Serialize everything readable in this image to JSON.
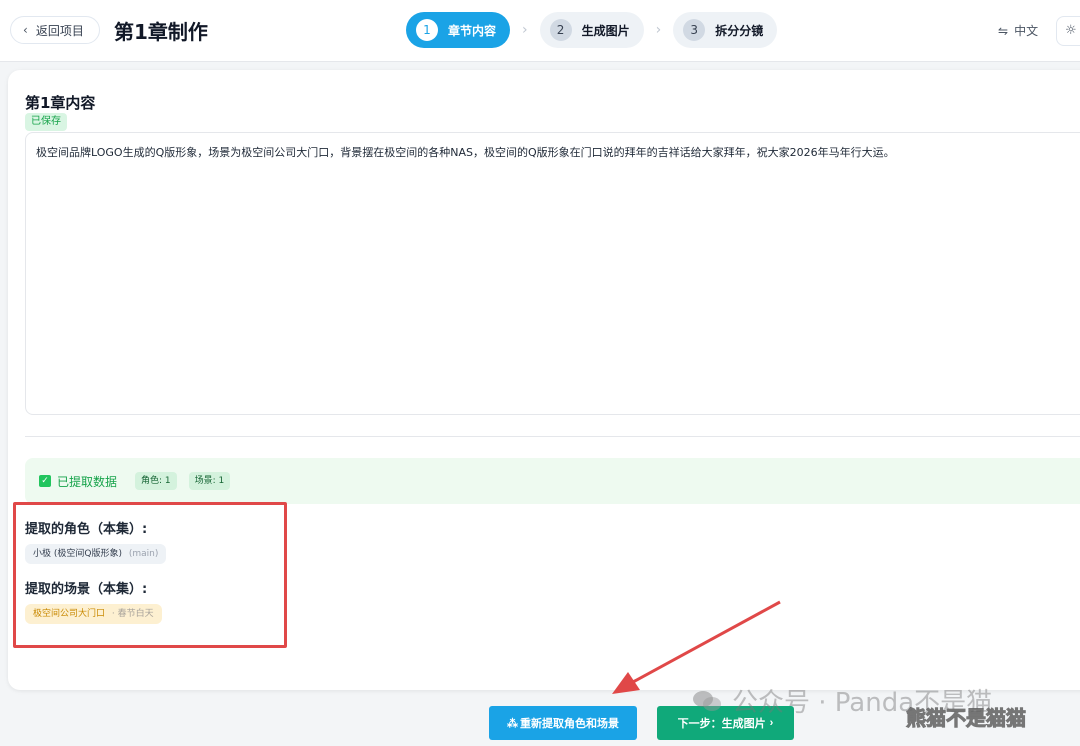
{
  "header": {
    "back_label": "返回项目",
    "title": "第1章制作",
    "steps": [
      {
        "num": "1",
        "label": "章节内容"
      },
      {
        "num": "2",
        "label": "生成图片"
      },
      {
        "num": "3",
        "label": "拆分分镜"
      }
    ],
    "lang_label": "中文"
  },
  "content": {
    "section_title": "第1章内容",
    "saved_badge": "已保存",
    "chapter_text": "极空间品牌LOGO生成的Q版形象，场景为极空间公司大门口，背景摆在极空间的各种NAS，极空间的Q版形象在门口说的拜年的吉祥话给大家拜年，祝大家2026年马年行大运。"
  },
  "extraction": {
    "status_label": "已提取数据",
    "roles_count": "角色: 1",
    "scenes_count": "场景: 1",
    "roles_title": "提取的角色（本集）:",
    "role_tag_name": "小极 (极空间Q版形象)",
    "role_tag_type": "(main)",
    "scenes_title": "提取的场景（本集）:",
    "scene_tag_name": "极空间公司大门口",
    "scene_tag_time": "· 春节白天"
  },
  "actions": {
    "re_extract_label": "重新提取角色和场景",
    "next_label": "下一步：生成图片"
  },
  "watermark": {
    "text": "公众号 · Panda不是猫",
    "text2": "熊猫不是猫猫"
  },
  "colors": {
    "primary": "#1aa3e6",
    "success": "#10a97a",
    "highlight": "#e04848"
  }
}
